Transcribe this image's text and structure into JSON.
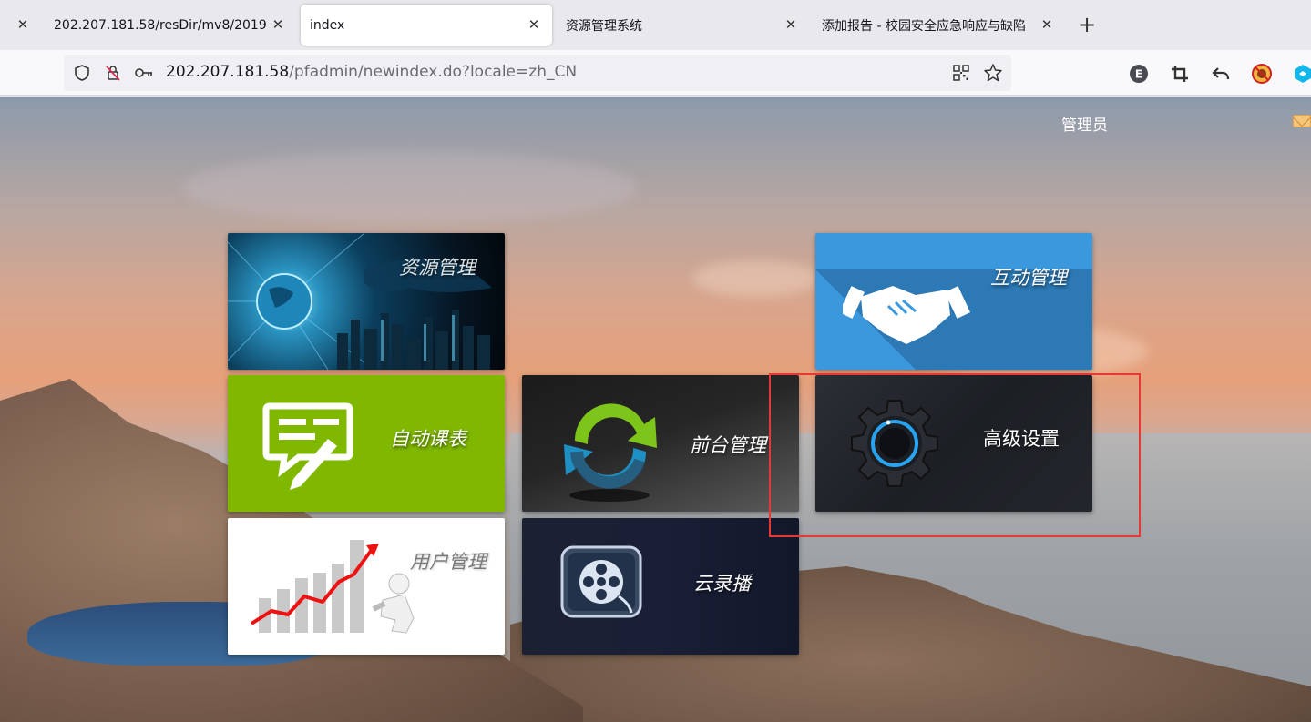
{
  "browser": {
    "tabs": [
      {
        "title": "202.207.181.58/resDir/mv8/2019",
        "active": false
      },
      {
        "title": "index",
        "active": true
      },
      {
        "title": "资源管理系统",
        "active": false
      },
      {
        "title": "添加报告 - 校园安全应急响应与缺陷",
        "active": false
      }
    ],
    "url_host": "202.207.181.58",
    "url_path": "/pfadmin/newindex.do?locale=zh_CN",
    "extension_badge": "E"
  },
  "page": {
    "user_label": "管理员",
    "tiles": [
      {
        "label": "资源管理"
      },
      {
        "label": "互动管理"
      },
      {
        "label": "自动课表"
      },
      {
        "label": "前台管理"
      },
      {
        "label": "高级设置"
      },
      {
        "label": "用户管理"
      },
      {
        "label": "云录播"
      }
    ]
  },
  "colors": {
    "highlight": "#e53935",
    "tile_interactive": "#3b98dc",
    "tile_schedule": "#80b800"
  }
}
